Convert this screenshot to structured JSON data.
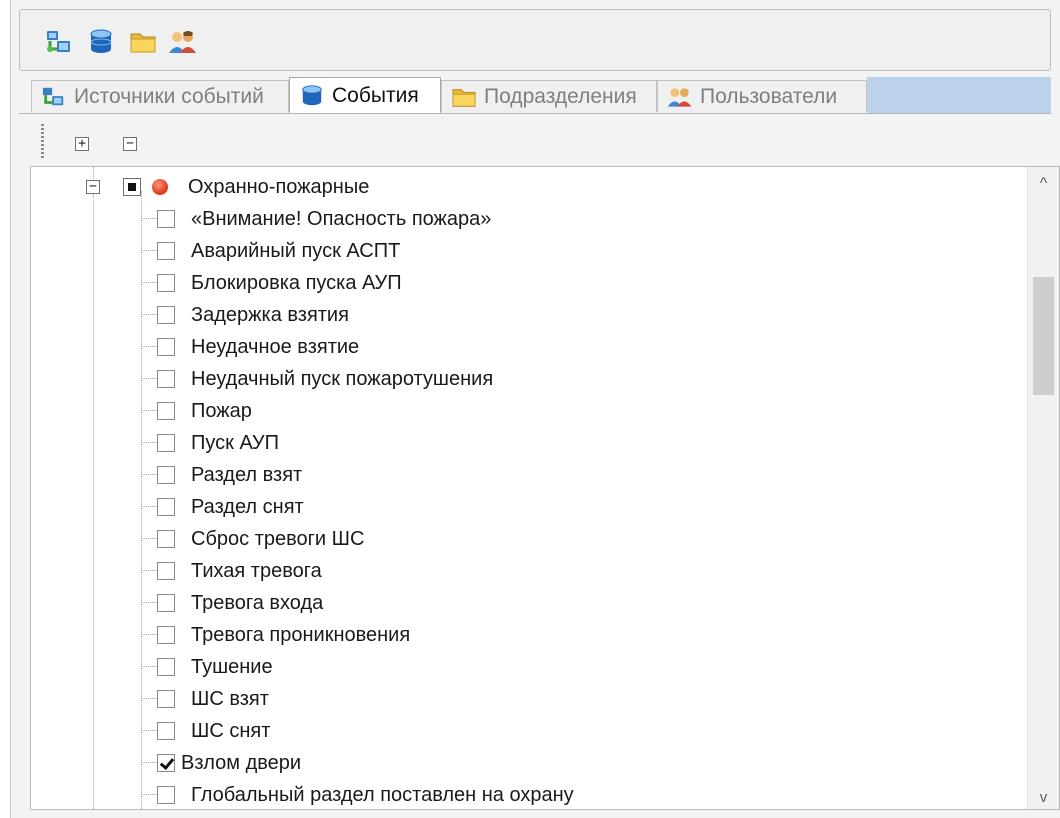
{
  "toolbar": {
    "buttons": [
      {
        "name": "event-sources-toolbar-button",
        "icon": "server-network-icon"
      },
      {
        "name": "events-toolbar-button",
        "icon": "database-icon"
      },
      {
        "name": "departments-toolbar-button",
        "icon": "folder-icon"
      },
      {
        "name": "users-toolbar-button",
        "icon": "users-icon"
      }
    ]
  },
  "tabs": [
    {
      "label": "Источники событий",
      "icon": "server-network-icon",
      "active": false
    },
    {
      "label": "События",
      "icon": "database-icon",
      "active": true
    },
    {
      "label": "Подразделения",
      "icon": "folder-icon",
      "active": false
    },
    {
      "label": "Пользователи",
      "icon": "users-icon",
      "active": false
    }
  ],
  "expand_bar": {
    "expand_all_symbol": "+",
    "collapse_all_symbol": "−"
  },
  "tree": {
    "root": {
      "label": "Охранно-пожарные",
      "expanded": true,
      "state": "partial",
      "status_color": "#e2401f",
      "expand_symbol": "−"
    },
    "items": [
      {
        "label": "«Внимание! Опасность пожара»",
        "checked": false
      },
      {
        "label": "Аварийный пуск АСПТ",
        "checked": false
      },
      {
        "label": "Блокировка пуска АУП",
        "checked": false
      },
      {
        "label": "Задержка взятия",
        "checked": false
      },
      {
        "label": "Неудачное взятие",
        "checked": false
      },
      {
        "label": "Неудачный пуск пожаротушения",
        "checked": false
      },
      {
        "label": "Пожар",
        "checked": false
      },
      {
        "label": "Пуск АУП",
        "checked": false
      },
      {
        "label": "Раздел взят",
        "checked": false
      },
      {
        "label": "Раздел снят",
        "checked": false
      },
      {
        "label": "Сброс тревоги ШС",
        "checked": false
      },
      {
        "label": "Тихая тревога",
        "checked": false
      },
      {
        "label": "Тревога входа",
        "checked": false
      },
      {
        "label": "Тревога проникновения",
        "checked": false
      },
      {
        "label": "Тушение",
        "checked": false
      },
      {
        "label": "ШС взят",
        "checked": false
      },
      {
        "label": "ШС снят",
        "checked": false
      },
      {
        "label": "Взлом двери",
        "checked": true
      },
      {
        "label": "Глобальный раздел поставлен на охрану",
        "checked": false
      }
    ]
  },
  "scrollbar": {
    "up_symbol": "^",
    "down_symbol": "v"
  }
}
